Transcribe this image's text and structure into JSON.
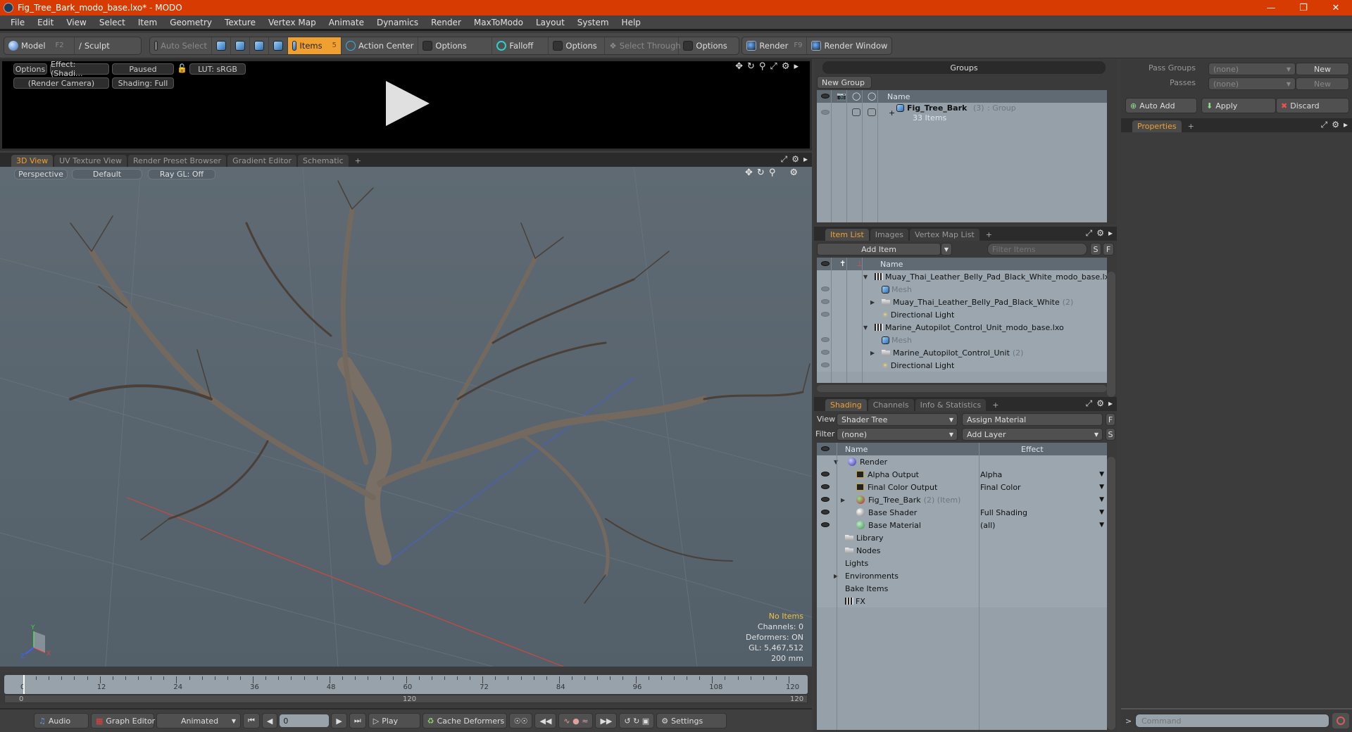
{
  "window": {
    "title": "Fig_Tree_Bark_modo_base.lxo* - MODO",
    "controls": [
      "minimize-icon",
      "restore-icon",
      "close-icon"
    ]
  },
  "menu": [
    "File",
    "Edit",
    "View",
    "Select",
    "Item",
    "Geometry",
    "Texture",
    "Vertex Map",
    "Animate",
    "Dynamics",
    "Render",
    "MaxToModo",
    "Layout",
    "System",
    "Help"
  ],
  "toolbar": {
    "model": "Model",
    "model_key": "F2",
    "sculpt": "Sculpt",
    "auto_select": "Auto Select",
    "items": "Items",
    "items_key": "5",
    "action_center": "Action Center",
    "options1": "Options",
    "falloff": "Falloff",
    "options2": "Options",
    "select_through": "Select Through",
    "options3": "Options",
    "render": "Render",
    "render_key": "F9",
    "render_window": "Render Window"
  },
  "render_view": {
    "options": "Options",
    "effect": "Effect: (Shadi...",
    "paused": "Paused",
    "lut": "LUT: sRGB",
    "camera": "(Render Camera)",
    "shading": "Shading: Full"
  },
  "viewport_tabs": [
    {
      "label": "3D View",
      "active": true
    },
    {
      "label": "UV Texture View"
    },
    {
      "label": "Render Preset Browser"
    },
    {
      "label": "Gradient Editor"
    },
    {
      "label": "Schematic"
    },
    {
      "label": "+"
    }
  ],
  "viewport": {
    "projection": "Perspective",
    "style": "Default",
    "raygl": "Ray GL: Off",
    "stats": {
      "selection": "No Items",
      "channels": "Channels: 0",
      "deformers": "Deformers: ON",
      "gl": "GL: 5,467,512",
      "grid": "200 mm"
    },
    "axes": {
      "x": "X",
      "y": "Y",
      "z": "Z"
    }
  },
  "timeline": {
    "ticks": [
      "0",
      "12",
      "24",
      "36",
      "48",
      "60",
      "72",
      "84",
      "96",
      "108",
      "120"
    ],
    "range_start": "0",
    "range_mid": "120",
    "range_end": "120",
    "current_frame": "0"
  },
  "transport": {
    "audio": "Audio",
    "graph_editor": "Graph Editor",
    "animated": "Animated",
    "frame": "0",
    "play": "Play",
    "cache_deformers": "Cache Deformers",
    "settings": "Settings"
  },
  "groups": {
    "title": "Groups",
    "new_group": "New Group",
    "name_col": "Name",
    "rows": [
      {
        "name": "Fig_Tree_Bark",
        "count": "(3)",
        "type": ": Group",
        "sub": "33 Items"
      }
    ]
  },
  "passes": {
    "pass_groups_label": "Pass Groups",
    "pass_groups_value": "(none)",
    "new1": "New",
    "passes_label": "Passes",
    "passes_value": "(none)",
    "new2": "New",
    "auto_add": "Auto Add",
    "apply": "Apply",
    "discard": "Discard"
  },
  "properties": {
    "tab": "Properties",
    "plus": "+"
  },
  "item_list": {
    "tabs": [
      {
        "label": "Item List",
        "active": true
      },
      {
        "label": "Images"
      },
      {
        "label": "Vertex Map List"
      },
      {
        "label": "+"
      }
    ],
    "add_item": "Add Item",
    "filter_placeholder": "Filter Items",
    "s": "S",
    "f": "F",
    "name_col": "Name",
    "rows": [
      {
        "name": "Muay_Thai_Leather_Belly_Pad_Black_White_modo_base.lxo",
        "kind": "scene",
        "level": 0,
        "eye": false
      },
      {
        "name": "Mesh",
        "kind": "mesh",
        "level": 1,
        "eye": true,
        "dim": true
      },
      {
        "name": "Muay_Thai_Leather_Belly_Pad_Black_White",
        "count": "(2)",
        "kind": "group",
        "level": 1,
        "eye": true
      },
      {
        "name": "Directional Light",
        "kind": "light",
        "level": 1,
        "eye": true
      },
      {
        "name": "Marine_Autopilot_Control_Unit_modo_base.lxo",
        "kind": "scene",
        "level": 0,
        "eye": false
      },
      {
        "name": "Mesh",
        "kind": "mesh",
        "level": 1,
        "eye": true,
        "dim": true
      },
      {
        "name": "Marine_Autopilot_Control_Unit",
        "count": "(2)",
        "kind": "group",
        "level": 1,
        "eye": true
      },
      {
        "name": "Directional Light",
        "kind": "light",
        "level": 1,
        "eye": true
      }
    ]
  },
  "shading": {
    "tabs": [
      {
        "label": "Shading",
        "active": true
      },
      {
        "label": "Channels"
      },
      {
        "label": "Info & Statistics"
      },
      {
        "label": "+"
      }
    ],
    "view_label": "View",
    "view_value": "Shader Tree",
    "assign_material": "Assign Material",
    "f": "F",
    "filter_label": "Filter",
    "filter_value": "(none)",
    "add_layer": "Add Layer",
    "s": "S",
    "name_col": "Name",
    "effect_col": "Effect",
    "rows": [
      {
        "name": "Render",
        "icon": "render",
        "level": 0,
        "eye": false,
        "effect": ""
      },
      {
        "name": "Alpha Output",
        "icon": "output",
        "level": 1,
        "eye": true,
        "effect": "Alpha"
      },
      {
        "name": "Final Color Output",
        "icon": "output",
        "level": 1,
        "eye": true,
        "effect": "Final Color"
      },
      {
        "name": "Fig_Tree_Bark",
        "suffix": "(2) (Item)",
        "icon": "material-group",
        "level": 1,
        "eye": true,
        "effect": ""
      },
      {
        "name": "Base Shader",
        "icon": "shader",
        "level": 1,
        "eye": true,
        "effect": "Full Shading"
      },
      {
        "name": "Base Material",
        "icon": "material",
        "level": 1,
        "eye": true,
        "effect": "(all)"
      },
      {
        "name": "Library",
        "icon": "folder",
        "level": -1
      },
      {
        "name": "Nodes",
        "icon": "folder",
        "level": -1
      },
      {
        "name": "Lights",
        "icon": "",
        "level": -1
      },
      {
        "name": "Environments",
        "icon": "",
        "level": -1
      },
      {
        "name": "Bake Items",
        "icon": "",
        "level": -1
      },
      {
        "name": "FX",
        "icon": "clapper",
        "level": -1
      }
    ]
  },
  "command": {
    "placeholder": "Command",
    "prompt": ">"
  }
}
